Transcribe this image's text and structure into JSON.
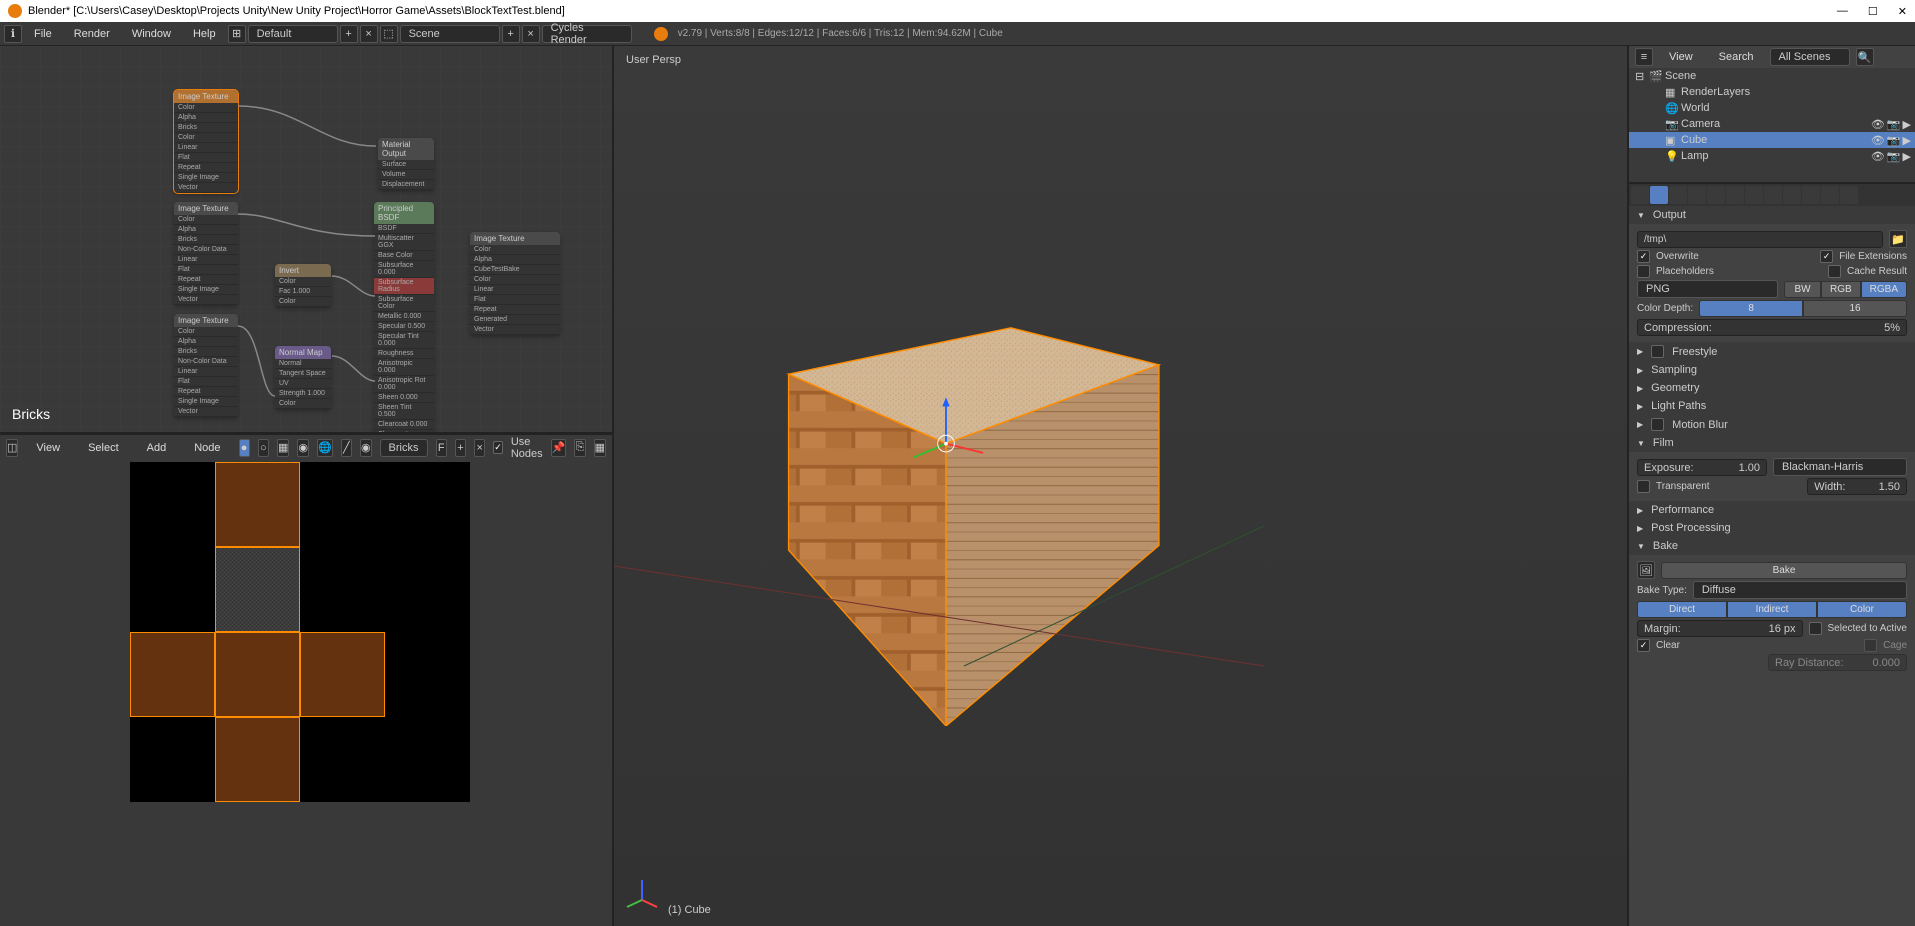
{
  "title": "Blender* [C:\\Users\\Casey\\Desktop\\Projects Unity\\New Unity Project\\Horror Game\\Assets\\BlockTextTest.blend]",
  "menubar": {
    "file": "File",
    "render": "Render",
    "window": "Window",
    "help": "Help",
    "layout": "Default",
    "scene": "Scene",
    "engine": "Cycles Render",
    "stats": "v2.79 | Verts:8/8 | Edges:12/12 | Faces:6/6 | Tris:12 | Mem:94.62M | Cube"
  },
  "node_editor": {
    "material_label": "Bricks",
    "nodes": {
      "tex1": "Image Texture",
      "tex2": "Image Texture",
      "tex3": "Image Texture",
      "tex4": "Image Texture",
      "invert": "Invert",
      "normal": "Normal Map",
      "bsdf": "Principled BSDF",
      "output": "Material Output"
    },
    "toolbar": {
      "view": "View",
      "select": "Select",
      "add": "Add",
      "node": "Node",
      "material": "Bricks",
      "use_nodes": "Use Nodes",
      "frame": "F"
    }
  },
  "viewport": {
    "persp": "User Persp",
    "object": "(1) Cube"
  },
  "outliner": {
    "header": {
      "view": "View",
      "search": "Search",
      "filter": "All Scenes"
    },
    "items": [
      {
        "label": "Scene",
        "indent": 0
      },
      {
        "label": "RenderLayers",
        "indent": 1
      },
      {
        "label": "World",
        "indent": 1
      },
      {
        "label": "Camera",
        "indent": 1
      },
      {
        "label": "Cube",
        "indent": 1,
        "selected": true
      },
      {
        "label": "Lamp",
        "indent": 1
      }
    ]
  },
  "properties": {
    "output": {
      "header": "Output",
      "path": "/tmp\\",
      "overwrite": "Overwrite",
      "file_ext": "File Extensions",
      "placeholders": "Placeholders",
      "cache": "Cache Result",
      "format": "PNG",
      "bw": "BW",
      "rgb": "RGB",
      "rgba": "RGBA",
      "depth_label": "Color Depth:",
      "depth8": "8",
      "depth16": "16",
      "compression_label": "Compression:",
      "compression_val": "5%"
    },
    "freestyle": "Freestyle",
    "sampling": "Sampling",
    "geometry": "Geometry",
    "light_paths": "Light Paths",
    "motion_blur": "Motion Blur",
    "film": {
      "header": "Film",
      "exposure_label": "Exposure:",
      "exposure_val": "1.00",
      "filter": "Blackman-Harris",
      "transparent": "Transparent",
      "width_label": "Width:",
      "width_val": "1.50"
    },
    "performance": "Performance",
    "post": "Post Processing",
    "bake": {
      "header": "Bake",
      "button": "Bake",
      "type_label": "Bake Type:",
      "type_val": "Diffuse",
      "direct": "Direct",
      "indirect": "Indirect",
      "color": "Color",
      "margin_label": "Margin:",
      "margin_val": "16 px",
      "sel_to_active": "Selected to Active",
      "clear": "Clear",
      "cage": "Cage",
      "ray_label": "Ray Distance:",
      "ray_val": "0.000"
    }
  }
}
